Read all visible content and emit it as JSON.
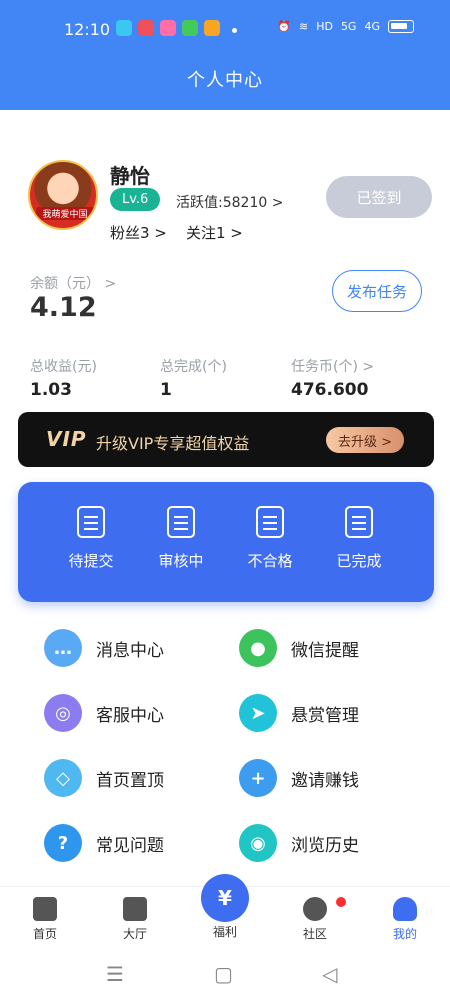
{
  "status": {
    "time": "12:10",
    "network": "HD",
    "signal1": "5G",
    "signal2": "4G"
  },
  "header": {
    "title": "个人中心"
  },
  "profile": {
    "avatar_caption": "我萌爱中国",
    "name": "静怡",
    "level": "Lv.6",
    "activity": "活跃值:58210 >",
    "fans": "粉丝3 >",
    "follow": "关注1 >",
    "signed_button": "已签到"
  },
  "balance": {
    "label": "余额（元） >",
    "value": "4.12",
    "publish_button": "发布任务"
  },
  "stats": [
    {
      "label": "总收益(元)",
      "value": "1.03"
    },
    {
      "label": "总完成(个)",
      "value": "1"
    },
    {
      "label": "任务币(个) >",
      "value": "476.600"
    }
  ],
  "vip": {
    "logo": "VIP",
    "text": "升级VIP专享超值权益",
    "button": "去升级 >"
  },
  "tasks": [
    {
      "label": "待提交"
    },
    {
      "label": "审核中"
    },
    {
      "label": "不合格"
    },
    {
      "label": "已完成"
    }
  ],
  "menu": [
    {
      "label": "消息中心",
      "icon": "message-icon",
      "color": "#5aa9f5",
      "glyph": "…"
    },
    {
      "label": "微信提醒",
      "icon": "wechat-icon",
      "color": "#3cc35c",
      "glyph": "●"
    },
    {
      "label": "客服中心",
      "icon": "customer-service-icon",
      "color": "#8b7cf0",
      "glyph": "◎"
    },
    {
      "label": "悬赏管理",
      "icon": "send-icon",
      "color": "#22c3d8",
      "glyph": "➤"
    },
    {
      "label": "首页置顶",
      "icon": "pin-icon",
      "color": "#4fb8f0",
      "glyph": "◇"
    },
    {
      "label": "邀请赚钱",
      "icon": "invite-icon",
      "color": "#3b9cf0",
      "glyph": "+"
    },
    {
      "label": "常见问题",
      "icon": "faq-icon",
      "color": "#2f96ee",
      "glyph": "?"
    },
    {
      "label": "浏览历史",
      "icon": "history-icon",
      "color": "#21c6c4",
      "glyph": "◉"
    }
  ],
  "nav": [
    {
      "label": "首页"
    },
    {
      "label": "大厅"
    },
    {
      "label": "福利"
    },
    {
      "label": "社区"
    },
    {
      "label": "我的"
    }
  ],
  "system_nav": {
    "menu": "☰",
    "home": "▢",
    "back": "◁"
  }
}
